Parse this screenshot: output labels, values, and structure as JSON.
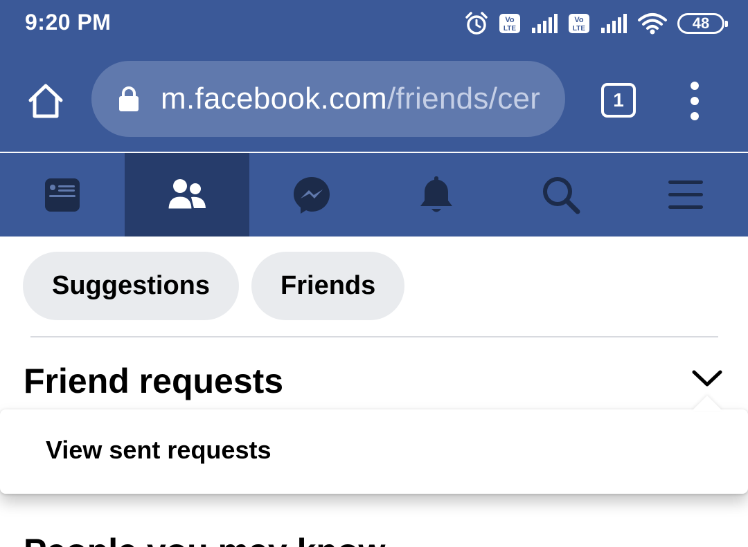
{
  "status_bar": {
    "time": "9:20 PM",
    "battery": "48",
    "network_badge_1": "Vo LTE",
    "network_badge_2": "Vo LTE",
    "icons": [
      "alarm-icon",
      "volte-icon",
      "signal-icon",
      "volte-icon",
      "signal-icon",
      "wifi-icon",
      "battery-icon"
    ]
  },
  "browser": {
    "url_host": "m.facebook.com",
    "url_path": "/friends/cer",
    "tab_count": "1",
    "icons": [
      "home-icon",
      "lock-icon",
      "tabs-icon",
      "more-vertical-icon"
    ]
  },
  "fb_nav": {
    "items": [
      {
        "name": "news-feed",
        "icon": "news-feed-icon",
        "active": false
      },
      {
        "name": "friends",
        "icon": "friends-icon",
        "active": true
      },
      {
        "name": "messenger",
        "icon": "messenger-icon",
        "active": false
      },
      {
        "name": "notifications",
        "icon": "bell-icon",
        "active": false
      },
      {
        "name": "search",
        "icon": "search-icon",
        "active": false
      },
      {
        "name": "menu",
        "icon": "hamburger-icon",
        "active": false
      }
    ]
  },
  "main": {
    "chips": [
      {
        "label": "Suggestions"
      },
      {
        "label": "Friends"
      }
    ],
    "section_title": "Friend requests",
    "dropdown": {
      "item_label": "View sent requests"
    },
    "next_section_peek": "People you may know"
  },
  "colors": {
    "brand": "#3b5998",
    "nav_active": "#263c6b",
    "url_pill": "#6079ad",
    "chip_bg": "#e9ebee",
    "icon_dark": "#1c2b4a"
  }
}
